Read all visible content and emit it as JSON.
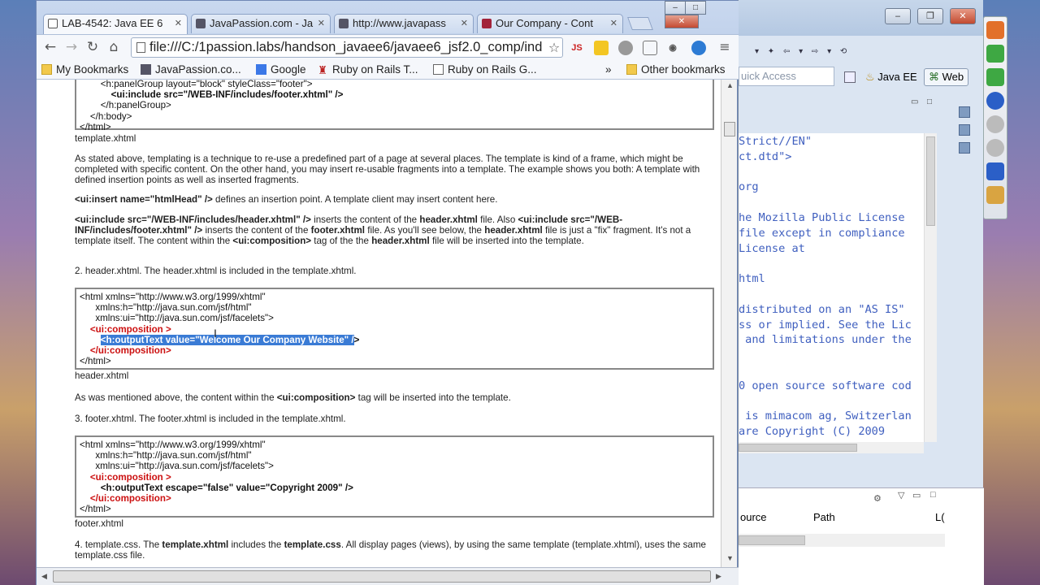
{
  "browser": {
    "tabs": [
      {
        "label": "LAB-4542: Java EE 6",
        "active": true
      },
      {
        "label": "JavaPassion.com - Ja",
        "active": false
      },
      {
        "label": "http://www.javapass",
        "active": false
      },
      {
        "label": "Our Company - Cont",
        "active": false
      }
    ],
    "url": "file:///C:/1passion.labs/handson_javaee6/javaee6_jsf2.0_comp/ind",
    "bookmarks": [
      {
        "label": "My Bookmarks"
      },
      {
        "label": "JavaPassion.co..."
      },
      {
        "label": "Google"
      },
      {
        "label": "Ruby on Rails T..."
      },
      {
        "label": "Ruby on Rails G..."
      }
    ],
    "bookmarks_overflow": "»",
    "other_bookmarks": "Other bookmarks",
    "ext_js": "JS"
  },
  "page": {
    "code_top": [
      "        <h:panelGroup layout=\"block\" styleClass=\"footer\">",
      "            <ui:include src=\"/WEB-INF/includes/footer.xhtml\" />",
      "        </h:panelGroup>",
      "    </h:body>",
      "</html>"
    ],
    "caption1": "template.xhtml",
    "para1": "As stated above, templating is a technique to re-use a predefined part of a page at several places. The template is kind of a frame, which might be completed with specific content. On the other hand, you may insert re-usable fragments into a template.  The example shows you both: A template with defined insertion points as well as inserted fragments.",
    "para2_code": "<ui:insert name=\"htmlHead\" />",
    "para2_text": " defines an insertion point. A template client may insert content here.",
    "para3": {
      "c1": "<ui:include src=\"/WEB-INF/includes/header.xhtml\" />",
      "t1": " inserts the content of the ",
      "c2": "header.xhtml",
      "t2": " file.  Also ",
      "c3": "<ui:include src=\"/WEB-INF/includes/footer.xhtml\" />",
      "t3": " inserts the content of the ",
      "c4": "footer.xhtml",
      "t4": " file.  As you'll see below, the ",
      "c5": "header.xhtml",
      "t5": " file is just a \"fix\" fragment. It's not a template itself. The content within the ",
      "c6": "<ui:composition>",
      "t6": " tag of the the ",
      "c7": "header.xhtml",
      "t7": " file  will be inserted into the template."
    },
    "step2": "2. header.xhtml.  The header.xhtml is included in the template.xhtml.",
    "header_code": {
      "l1": "<html xmlns=\"http://www.w3.org/1999/xhtml\"",
      "l2": "      xmlns:h=\"http://java.sun.com/jsf/html\"",
      "l3": "      xmlns:ui=\"http://java.sun.com/jsf/facelets\">",
      "l4": "    <ui:composition >",
      "l5_sel": "<h:outputText value=\"Welcome Our Company Website\" /",
      "l5_rest": ">",
      "l6": "    </ui:composition>",
      "l7": "</html>"
    },
    "caption2": "header.xhtml",
    "para4_a": "As was mentioned above, the content within the ",
    "para4_code": "<ui:composition>",
    "para4_b": " tag will be inserted into the template.",
    "step3": "3. footer.xhtml.  The footer.xhtml is included in the template.xhtml.",
    "footer_code": {
      "l1": "<html xmlns=\"http://www.w3.org/1999/xhtml\"",
      "l2": "      xmlns:h=\"http://java.sun.com/jsf/html\"",
      "l3": "      xmlns:ui=\"http://java.sun.com/jsf/facelets\">",
      "l4": "    <ui:composition >",
      "l5": "        <h:outputText escape=\"false\" value=\"Copyright 2009\" />",
      "l6": "    </ui:composition>",
      "l7": "</html>"
    },
    "caption3": "footer.xhtml",
    "step4_a": "4. template.css.  The ",
    "step4_b": "template.xhtml",
    "step4_c": " includes the ",
    "step4_d": "template.css",
    "step4_e": ".  All display pages (views), by using the same template (template.xhtml), uses the same template.css file."
  },
  "eclipse": {
    "quick_access": "uick Access",
    "perspectives": [
      {
        "label": "Java EE"
      },
      {
        "label": "Web"
      }
    ],
    "editor_lines": [
      "Strict//EN\"",
      "ct.dtd\">",
      "",
      "org",
      "",
      "he Mozilla Public License",
      "file except in compliance",
      "License at",
      "",
      "html",
      "",
      "distributed on an \"AS IS\"",
      "ss or implied. See the Lic",
      " and limitations under the",
      "",
      "",
      "0 open source software cod",
      "",
      " is mimacom ag, Switzerlan",
      "are Copyright (C) 2009"
    ],
    "col_source": "ource",
    "col_path": "Path",
    "col_l": "L("
  }
}
